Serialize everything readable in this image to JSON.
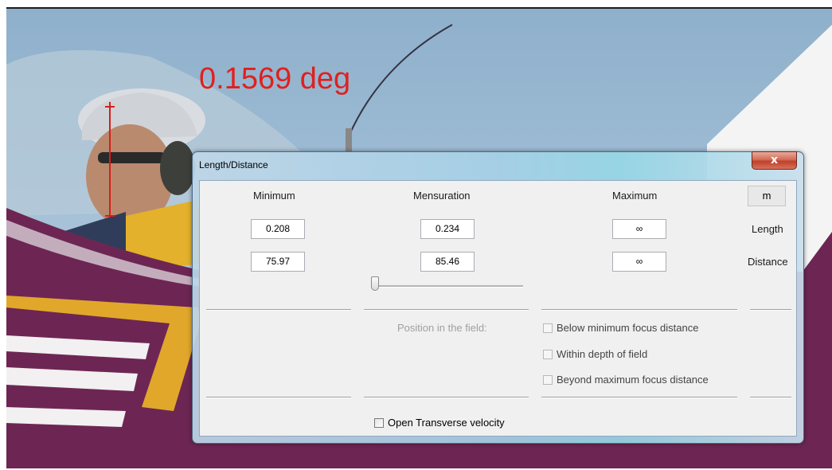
{
  "overlay": {
    "angle_text": "0.1569 deg"
  },
  "dialog": {
    "title": "Length/Distance",
    "close_label": "x",
    "headers": {
      "minimum": "Minimum",
      "mensuration": "Mensuration",
      "maximum": "Maximum"
    },
    "unit": "m",
    "rows": {
      "length": {
        "label": "Length",
        "minimum": "0.208",
        "mensuration": "0.234",
        "maximum": "∞"
      },
      "distance": {
        "label": "Distance",
        "minimum": "75.97",
        "mensuration": "85.46",
        "maximum": "∞"
      }
    },
    "position_label": "Position in the field:",
    "checkboxes": [
      {
        "label": "Below minimum focus distance",
        "checked": false
      },
      {
        "label": "Within depth of field",
        "checked": false
      },
      {
        "label": "Beyond maximum focus distance",
        "checked": false
      }
    ],
    "transverse": {
      "label": "Open Transverse velocity",
      "checked": false
    }
  },
  "colors": {
    "overlay_red": "#e0201e",
    "dialog_frame": "#a6d0e6",
    "close_red": "#c0402a"
  }
}
